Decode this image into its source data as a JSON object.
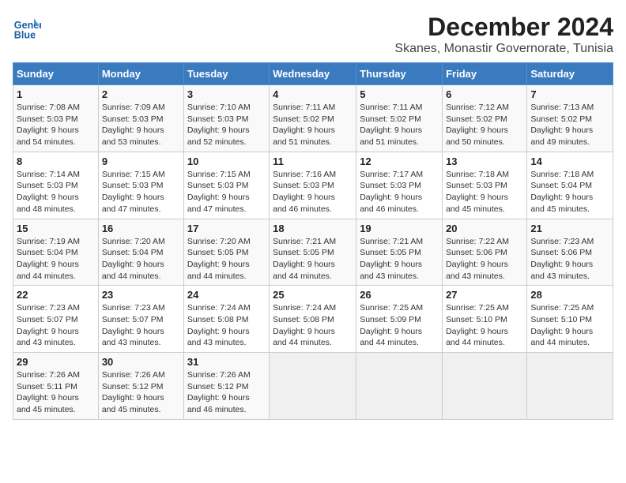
{
  "header": {
    "logo_line1": "General",
    "logo_line2": "Blue",
    "title": "December 2024",
    "subtitle": "Skanes, Monastir Governorate, Tunisia"
  },
  "columns": [
    "Sunday",
    "Monday",
    "Tuesday",
    "Wednesday",
    "Thursday",
    "Friday",
    "Saturday"
  ],
  "weeks": [
    [
      {
        "day": "1",
        "info": "Sunrise: 7:08 AM\nSunset: 5:03 PM\nDaylight: 9 hours\nand 54 minutes."
      },
      {
        "day": "2",
        "info": "Sunrise: 7:09 AM\nSunset: 5:03 PM\nDaylight: 9 hours\nand 53 minutes."
      },
      {
        "day": "3",
        "info": "Sunrise: 7:10 AM\nSunset: 5:03 PM\nDaylight: 9 hours\nand 52 minutes."
      },
      {
        "day": "4",
        "info": "Sunrise: 7:11 AM\nSunset: 5:02 PM\nDaylight: 9 hours\nand 51 minutes."
      },
      {
        "day": "5",
        "info": "Sunrise: 7:11 AM\nSunset: 5:02 PM\nDaylight: 9 hours\nand 51 minutes."
      },
      {
        "day": "6",
        "info": "Sunrise: 7:12 AM\nSunset: 5:02 PM\nDaylight: 9 hours\nand 50 minutes."
      },
      {
        "day": "7",
        "info": "Sunrise: 7:13 AM\nSunset: 5:02 PM\nDaylight: 9 hours\nand 49 minutes."
      }
    ],
    [
      {
        "day": "8",
        "info": "Sunrise: 7:14 AM\nSunset: 5:03 PM\nDaylight: 9 hours\nand 48 minutes."
      },
      {
        "day": "9",
        "info": "Sunrise: 7:15 AM\nSunset: 5:03 PM\nDaylight: 9 hours\nand 47 minutes."
      },
      {
        "day": "10",
        "info": "Sunrise: 7:15 AM\nSunset: 5:03 PM\nDaylight: 9 hours\nand 47 minutes."
      },
      {
        "day": "11",
        "info": "Sunrise: 7:16 AM\nSunset: 5:03 PM\nDaylight: 9 hours\nand 46 minutes."
      },
      {
        "day": "12",
        "info": "Sunrise: 7:17 AM\nSunset: 5:03 PM\nDaylight: 9 hours\nand 46 minutes."
      },
      {
        "day": "13",
        "info": "Sunrise: 7:18 AM\nSunset: 5:03 PM\nDaylight: 9 hours\nand 45 minutes."
      },
      {
        "day": "14",
        "info": "Sunrise: 7:18 AM\nSunset: 5:04 PM\nDaylight: 9 hours\nand 45 minutes."
      }
    ],
    [
      {
        "day": "15",
        "info": "Sunrise: 7:19 AM\nSunset: 5:04 PM\nDaylight: 9 hours\nand 44 minutes."
      },
      {
        "day": "16",
        "info": "Sunrise: 7:20 AM\nSunset: 5:04 PM\nDaylight: 9 hours\nand 44 minutes."
      },
      {
        "day": "17",
        "info": "Sunrise: 7:20 AM\nSunset: 5:05 PM\nDaylight: 9 hours\nand 44 minutes."
      },
      {
        "day": "18",
        "info": "Sunrise: 7:21 AM\nSunset: 5:05 PM\nDaylight: 9 hours\nand 44 minutes."
      },
      {
        "day": "19",
        "info": "Sunrise: 7:21 AM\nSunset: 5:05 PM\nDaylight: 9 hours\nand 43 minutes."
      },
      {
        "day": "20",
        "info": "Sunrise: 7:22 AM\nSunset: 5:06 PM\nDaylight: 9 hours\nand 43 minutes."
      },
      {
        "day": "21",
        "info": "Sunrise: 7:23 AM\nSunset: 5:06 PM\nDaylight: 9 hours\nand 43 minutes."
      }
    ],
    [
      {
        "day": "22",
        "info": "Sunrise: 7:23 AM\nSunset: 5:07 PM\nDaylight: 9 hours\nand 43 minutes."
      },
      {
        "day": "23",
        "info": "Sunrise: 7:23 AM\nSunset: 5:07 PM\nDaylight: 9 hours\nand 43 minutes."
      },
      {
        "day": "24",
        "info": "Sunrise: 7:24 AM\nSunset: 5:08 PM\nDaylight: 9 hours\nand 43 minutes."
      },
      {
        "day": "25",
        "info": "Sunrise: 7:24 AM\nSunset: 5:08 PM\nDaylight: 9 hours\nand 44 minutes."
      },
      {
        "day": "26",
        "info": "Sunrise: 7:25 AM\nSunset: 5:09 PM\nDaylight: 9 hours\nand 44 minutes."
      },
      {
        "day": "27",
        "info": "Sunrise: 7:25 AM\nSunset: 5:10 PM\nDaylight: 9 hours\nand 44 minutes."
      },
      {
        "day": "28",
        "info": "Sunrise: 7:25 AM\nSunset: 5:10 PM\nDaylight: 9 hours\nand 44 minutes."
      }
    ],
    [
      {
        "day": "29",
        "info": "Sunrise: 7:26 AM\nSunset: 5:11 PM\nDaylight: 9 hours\nand 45 minutes."
      },
      {
        "day": "30",
        "info": "Sunrise: 7:26 AM\nSunset: 5:12 PM\nDaylight: 9 hours\nand 45 minutes."
      },
      {
        "day": "31",
        "info": "Sunrise: 7:26 AM\nSunset: 5:12 PM\nDaylight: 9 hours\nand 46 minutes."
      },
      null,
      null,
      null,
      null
    ]
  ]
}
